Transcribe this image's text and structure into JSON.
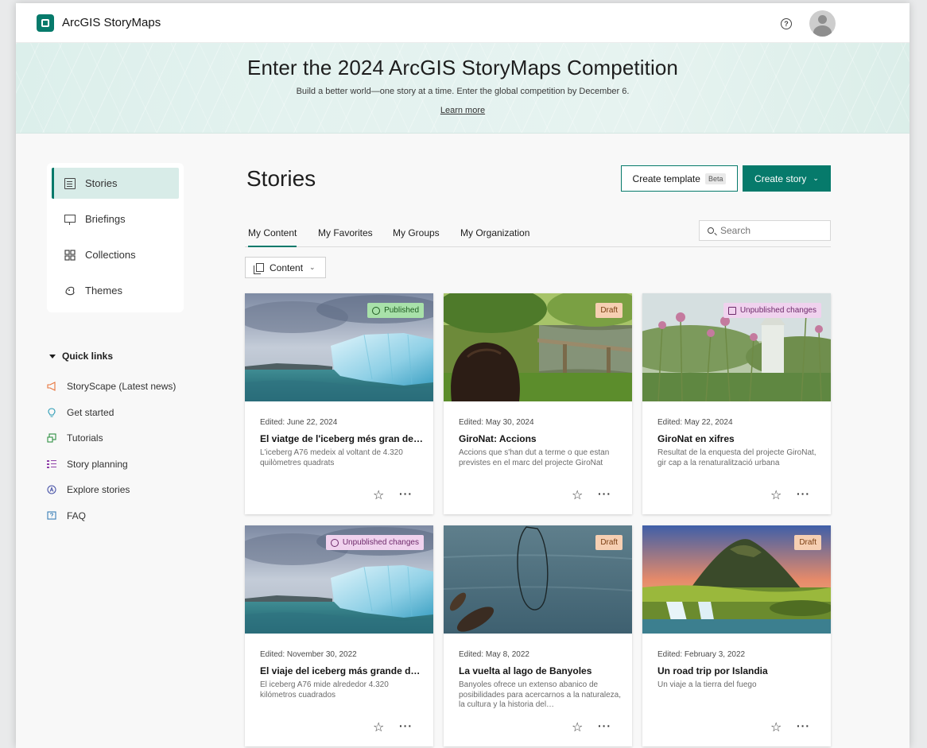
{
  "app": {
    "title": "ArcGIS StoryMaps"
  },
  "banner": {
    "title": "Enter the 2024 ArcGIS StoryMaps Competition",
    "subtitle": "Build a better world—one story at a time. Enter the global competition by December 6.",
    "link": "Learn more"
  },
  "sidebar": {
    "items": [
      {
        "label": "Stories",
        "icon": "document-icon",
        "active": true
      },
      {
        "label": "Briefings",
        "icon": "presentation-icon",
        "active": false
      },
      {
        "label": "Collections",
        "icon": "grid-icon",
        "active": false
      },
      {
        "label": "Themes",
        "icon": "palette-icon",
        "active": false
      }
    ],
    "quick_links_title": "Quick links",
    "quick_links": [
      {
        "label": "StoryScape (Latest news)",
        "icon": "megaphone-icon",
        "color": "#e8743b"
      },
      {
        "label": "Get started",
        "icon": "lightbulb-icon",
        "color": "#2b9bb5"
      },
      {
        "label": "Tutorials",
        "icon": "tutorial-icon",
        "color": "#2f8f42"
      },
      {
        "label": "Story planning",
        "icon": "checklist-icon",
        "color": "#8f3fa8"
      },
      {
        "label": "Explore stories",
        "icon": "explore-icon",
        "color": "#4a55a8"
      },
      {
        "label": "FAQ",
        "icon": "faq-icon",
        "color": "#3a7fb8"
      }
    ]
  },
  "main": {
    "title": "Stories",
    "create_template_label": "Create template",
    "beta_label": "Beta",
    "create_story_label": "Create story",
    "tabs": [
      {
        "label": "My Content",
        "active": true
      },
      {
        "label": "My Favorites",
        "active": false
      },
      {
        "label": "My Groups",
        "active": false
      },
      {
        "label": "My Organization",
        "active": false
      }
    ],
    "search_placeholder": "Search",
    "filter_label": "Content"
  },
  "cards": [
    {
      "status": "Published",
      "edited": "Edited: June 22, 2024",
      "title": "El viatge de l'iceberg més gran del món",
      "desc": "L'iceberg A76 medeix al voltant de 4.320 quilòmetres quadrats"
    },
    {
      "status": "Draft",
      "edited": "Edited: May 30, 2024",
      "title": "GiroNat: Accions",
      "desc": "Accions que s'han dut a terme o que estan previstes en el marc del projecte GiroNat"
    },
    {
      "status": "Unpublished changes",
      "edited": "Edited: May 22, 2024",
      "title": "GiroNat en xifres",
      "desc": "Resultat de la enquesta del projecte GiroNat, gir cap a la renaturalització urbana"
    },
    {
      "status": "Unpublished changes",
      "edited": "Edited: November 30, 2022",
      "title": "El viaje del iceberg más grande del mundo",
      "desc": "El iceberg A76 mide alrededor 4.320 kilómetros cuadrados"
    },
    {
      "status": "Draft",
      "edited": "Edited: May 8, 2022",
      "title": "La vuelta al lago de Banyoles",
      "desc": "Banyoles ofrece un extenso abanico de posibilidades para acercarnos a la naturaleza, la cultura y la historia del…"
    },
    {
      "status": "Draft",
      "edited": "Edited: February 3, 2022",
      "title": "Un road trip por Islandia",
      "desc": "Un viaje a la tierra del fuego"
    }
  ],
  "colors": {
    "accent": "#067a6b",
    "published": "#a8e1a9",
    "draft": "#f6cfb2",
    "unpublished": "#f0d2ee"
  }
}
